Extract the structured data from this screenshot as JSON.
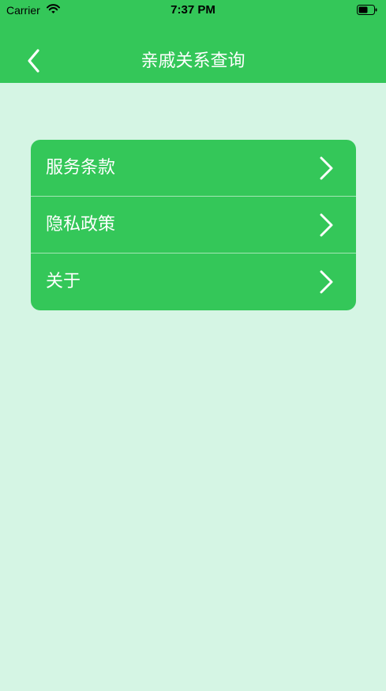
{
  "status_bar": {
    "carrier": "Carrier",
    "time": "7:37 PM",
    "icons": [
      "wifi-icon",
      "battery-icon"
    ]
  },
  "nav": {
    "title": "亲戚关系查询",
    "back_icon": "chevron-left-icon"
  },
  "menu": {
    "items": [
      {
        "label": "服务条款",
        "icon": "chevron-right-icon"
      },
      {
        "label": "隐私政策",
        "icon": "chevron-right-icon"
      },
      {
        "label": "关于",
        "icon": "chevron-right-icon"
      }
    ]
  },
  "colors": {
    "primary": "#34c759",
    "background": "#d5f5e4",
    "text_on_primary": "#ffffff"
  }
}
